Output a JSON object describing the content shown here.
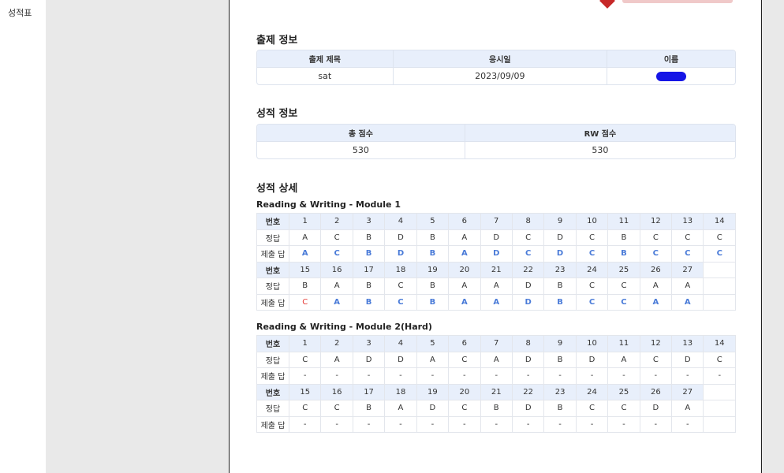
{
  "sidebar_label": "성적표",
  "logo": "logo-mark",
  "exam_info": {
    "section_title": "출제 정보",
    "headers": [
      "출제 제목",
      "응시일",
      "이름"
    ],
    "title": "sat",
    "date": "2023/09/09"
  },
  "score_info": {
    "section_title": "성적 정보",
    "headers": [
      "총 점수",
      "RW 점수"
    ],
    "total": "530",
    "rw": "530"
  },
  "detail": {
    "section_title": "성적 상세",
    "row_labels": {
      "number": "번호",
      "answer": "정답",
      "submitted": "제출 답"
    },
    "modules": [
      {
        "title": "Reading & Writing - Module 1",
        "numbers": [
          "1",
          "2",
          "3",
          "4",
          "5",
          "6",
          "7",
          "8",
          "9",
          "10",
          "11",
          "12",
          "13",
          "14",
          "15",
          "16",
          "17",
          "18",
          "19",
          "20",
          "21",
          "22",
          "23",
          "24",
          "25",
          "26",
          "27"
        ],
        "answers": [
          "A",
          "C",
          "B",
          "D",
          "B",
          "A",
          "D",
          "C",
          "D",
          "C",
          "B",
          "C",
          "C",
          "C",
          "B",
          "A",
          "B",
          "C",
          "B",
          "A",
          "A",
          "D",
          "B",
          "C",
          "C",
          "A",
          "A"
        ],
        "submitted": [
          "A",
          "C",
          "B",
          "D",
          "B",
          "A",
          "D",
          "C",
          "D",
          "C",
          "B",
          "C",
          "C",
          "C",
          "C",
          "A",
          "B",
          "C",
          "B",
          "A",
          "A",
          "D",
          "B",
          "C",
          "C",
          "A",
          "A"
        ]
      },
      {
        "title": "Reading & Writing - Module 2(Hard)",
        "numbers": [
          "1",
          "2",
          "3",
          "4",
          "5",
          "6",
          "7",
          "8",
          "9",
          "10",
          "11",
          "12",
          "13",
          "14",
          "15",
          "16",
          "17",
          "18",
          "19",
          "20",
          "21",
          "22",
          "23",
          "24",
          "25",
          "26",
          "27"
        ],
        "answers": [
          "C",
          "A",
          "D",
          "D",
          "A",
          "C",
          "A",
          "D",
          "B",
          "D",
          "A",
          "C",
          "D",
          "C",
          "C",
          "C",
          "B",
          "A",
          "D",
          "C",
          "B",
          "D",
          "B",
          "C",
          "C",
          "D",
          "A"
        ],
        "submitted": [
          "-",
          "-",
          "-",
          "-",
          "-",
          "-",
          "-",
          "-",
          "-",
          "-",
          "-",
          "-",
          "-",
          "-",
          "-",
          "-",
          "-",
          "-",
          "-",
          "-",
          "-",
          "-",
          "-",
          "-",
          "-",
          "-",
          "-"
        ]
      }
    ]
  }
}
